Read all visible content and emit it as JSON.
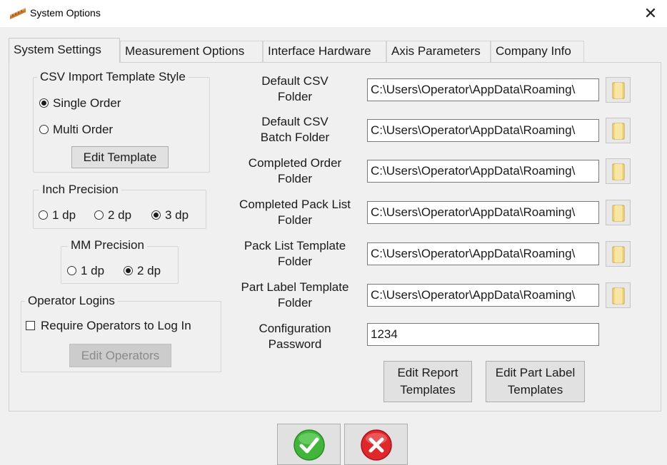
{
  "window": {
    "title": "System Options",
    "icon": "ruler-app-icon",
    "close_glyph": "✕"
  },
  "tabs": [
    {
      "label": "System Settings",
      "active": true
    },
    {
      "label": "Measurement Options",
      "active": false
    },
    {
      "label": "Interface Hardware",
      "active": false
    },
    {
      "label": "Axis Parameters",
      "active": false
    },
    {
      "label": "Company Info",
      "active": false
    }
  ],
  "csv_style": {
    "title": "CSV Import Template Style",
    "options": [
      {
        "label": "Single Order",
        "selected": true
      },
      {
        "label": "Multi Order",
        "selected": false
      }
    ],
    "edit_button": "Edit Template"
  },
  "inch_precision": {
    "title": "Inch Precision",
    "options": [
      {
        "label": "1 dp",
        "selected": false
      },
      {
        "label": "2 dp",
        "selected": false
      },
      {
        "label": "3 dp",
        "selected": true
      }
    ]
  },
  "mm_precision": {
    "title": "MM Precision",
    "options": [
      {
        "label": "1 dp",
        "selected": false
      },
      {
        "label": "2 dp",
        "selected": true
      }
    ]
  },
  "operator_logins": {
    "title": "Operator Logins",
    "checkbox_label": "Require Operators to Log In",
    "checked": false,
    "edit_button": "Edit Operators",
    "edit_button_enabled": false
  },
  "folders": [
    {
      "label_line1": "Default CSV",
      "label_line2": "Folder",
      "value": "C:\\Users\\Operator\\AppData\\Roaming\\"
    },
    {
      "label_line1": "Default CSV",
      "label_line2": "Batch Folder",
      "value": "C:\\Users\\Operator\\AppData\\Roaming\\"
    },
    {
      "label_line1": "Completed Order",
      "label_line2": "Folder",
      "value": "C:\\Users\\Operator\\AppData\\Roaming\\"
    },
    {
      "label_line1": "Completed Pack List",
      "label_line2": "Folder",
      "value": "C:\\Users\\Operator\\AppData\\Roaming\\"
    },
    {
      "label_line1": "Pack List Template",
      "label_line2": "Folder",
      "value": "C:\\Users\\Operator\\AppData\\Roaming\\"
    },
    {
      "label_line1": "Part Label Template",
      "label_line2": "Folder",
      "value": "C:\\Users\\Operator\\AppData\\Roaming\\"
    }
  ],
  "password": {
    "label_line1": "Configuration",
    "label_line2": "Password",
    "value": "1234"
  },
  "buttons": {
    "edit_report_line1": "Edit Report",
    "edit_report_line2": "Templates",
    "edit_part_label_line1": "Edit Part Label",
    "edit_part_label_line2": "Templates"
  },
  "dialog": {
    "ok_icon": "green-checkmark-icon",
    "cancel_icon": "red-x-icon"
  },
  "colors": {
    "ok_green": "#3fb53a",
    "cancel_red": "#e0282c",
    "folder_yellow": "#f3d77a"
  }
}
